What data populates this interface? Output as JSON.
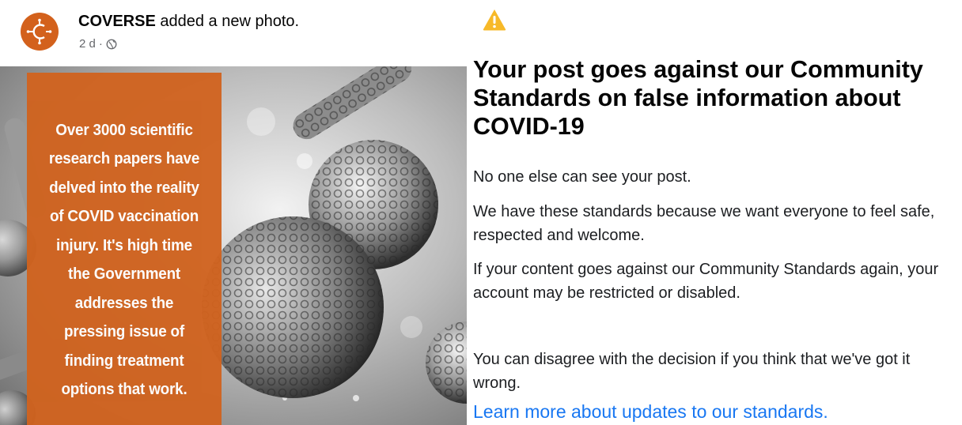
{
  "post": {
    "page_name": "COVERSE",
    "action_text": "added a new photo.",
    "time": "2 d",
    "separator": "·",
    "privacy_icon": "globe-icon",
    "image_text": "Over 3000 scientific research papers have delved into the reality of COVID vaccination injury. It's high time the Government addresses the pressing issue of finding treatment options that work."
  },
  "notice": {
    "icon": "warning-icon",
    "heading": "Your post goes against our Community Standards on false information about COVID-19",
    "p1": "No one else can see your post.",
    "p2": "We have these standards because we want everyone to feel safe, respected and welcome.",
    "p3": "If your content goes against our Community Standards again, your account may be restricted or disabled.",
    "p4": "You can disagree with the decision if you think that we've got it wrong.",
    "link": "Learn more about updates to our standards."
  },
  "colors": {
    "brand_orange": "#d0631f",
    "link_blue": "#1877f2",
    "warning_yellow": "#f7b928"
  }
}
